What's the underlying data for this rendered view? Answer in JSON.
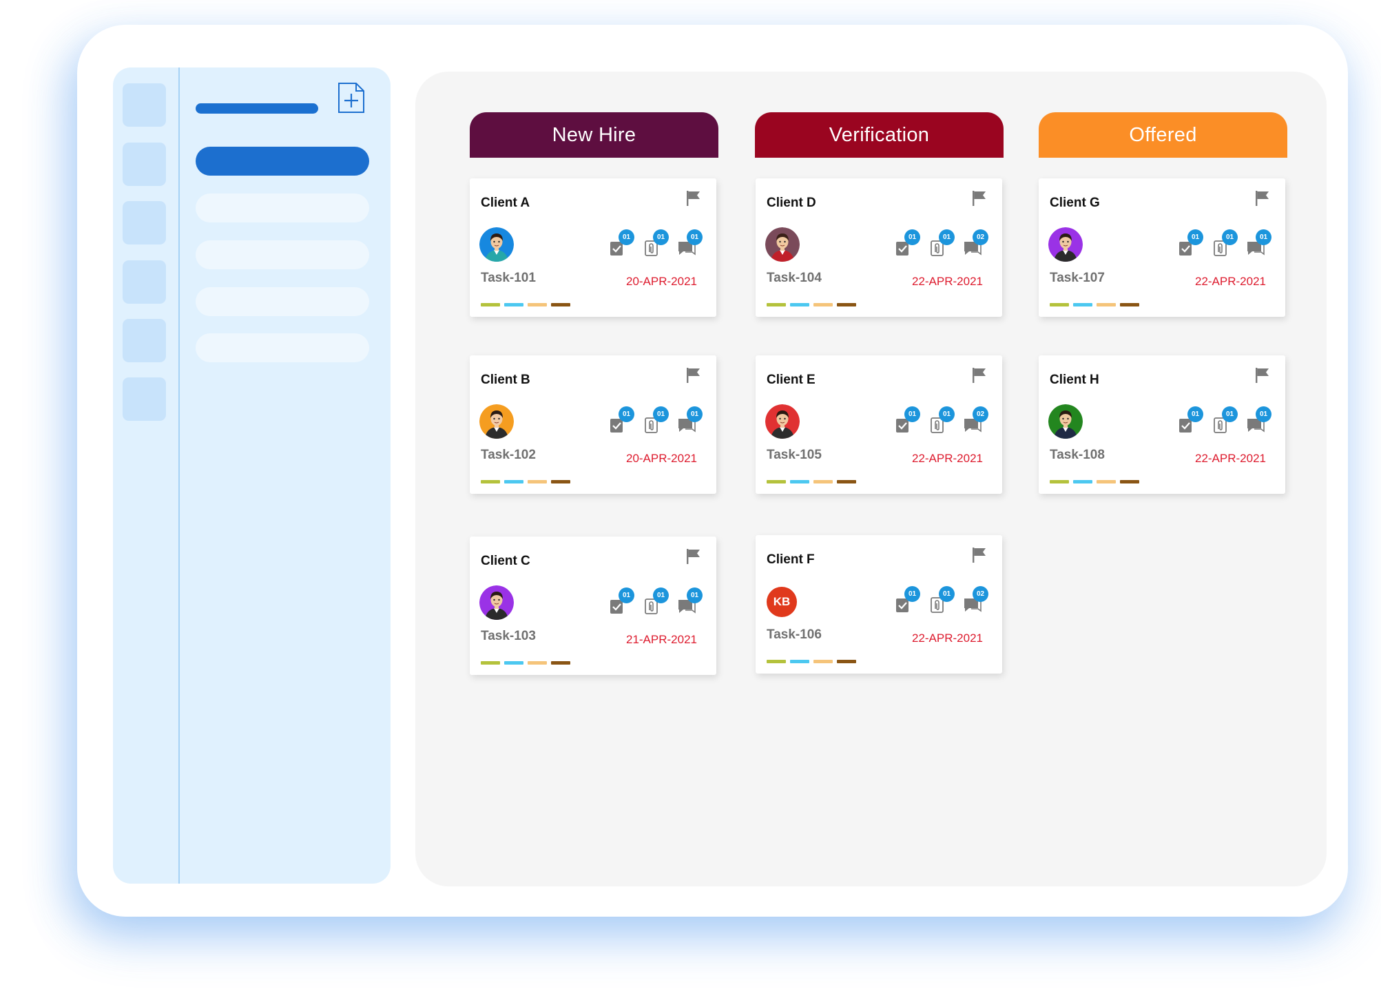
{
  "colors": {
    "frame_bg": "#ffffff",
    "sidebar_bg": "#e0f1fe",
    "accent_blue": "#1c6fcf",
    "board_bg": "#f5f5f5",
    "badge": "#1c95dc",
    "date_red": "#dd1a2d",
    "icon_gray": "#7a7a7a",
    "tags": [
      "#b4c23c",
      "#4cc8f0",
      "#f5c47a",
      "#8a5514"
    ]
  },
  "sidebar": {
    "new_icon": "file-plus-icon",
    "rail_item_count": 6,
    "nav_item_count": 5,
    "active_nav_index": 0
  },
  "board": {
    "columns": [
      {
        "title": "New Hire",
        "color": "#5e0e40",
        "cards": [
          {
            "client": "Client A",
            "task": "Task-101",
            "date": "20-APR-2021",
            "avatar": {
              "type": "person",
              "bg": "#1788df",
              "skin": "#f0c9a0",
              "hair": "#2e1c12",
              "shirt": "#26a7a9"
            },
            "counts": {
              "checklist": "01",
              "attachments": "01",
              "comments": "01"
            }
          },
          {
            "client": "Client B",
            "task": "Task-102",
            "date": "20-APR-2021",
            "avatar": {
              "type": "person",
              "bg": "#f59d20",
              "skin": "#f2cba5",
              "hair": "#2a1c14",
              "shirt": "#2c2c2c"
            },
            "counts": {
              "checklist": "01",
              "attachments": "01",
              "comments": "01"
            }
          },
          {
            "client": "Client C",
            "task": "Task-103",
            "date": "21-APR-2021",
            "avatar": {
              "type": "person",
              "bg": "#9a32e6",
              "skin": "#efc9a2",
              "hair": "#2a1c14",
              "shirt": "#2b2b2b"
            },
            "counts": {
              "checklist": "01",
              "attachments": "01",
              "comments": "01"
            }
          }
        ]
      },
      {
        "title": "Verification",
        "color": "#9a0520",
        "cards": [
          {
            "client": "Client D",
            "task": "Task-104",
            "date": "22-APR-2021",
            "avatar": {
              "type": "person",
              "bg": "#7a4a5a",
              "skin": "#f0c9a0",
              "hair": "#3a2018",
              "shirt": "#c0202a"
            },
            "counts": {
              "checklist": "01",
              "attachments": "01",
              "comments": "02"
            }
          },
          {
            "client": "Client E",
            "task": "Task-105",
            "date": "22-APR-2021",
            "avatar": {
              "type": "person",
              "bg": "#e03132",
              "skin": "#f0c9a0",
              "hair": "#2a1a12",
              "shirt": "#2d2d2d"
            },
            "counts": {
              "checklist": "01",
              "attachments": "01",
              "comments": "02"
            }
          },
          {
            "client": "Client F",
            "task": "Task-106",
            "date": "22-APR-2021",
            "avatar": {
              "type": "initials",
              "initials": "KB",
              "bg": "#e0391c"
            },
            "counts": {
              "checklist": "01",
              "attachments": "01",
              "comments": "02"
            }
          }
        ]
      },
      {
        "title": "Offered",
        "color": "#fb8e26",
        "cards": [
          {
            "client": "Client G",
            "task": "Task-107",
            "date": "22-APR-2021",
            "avatar": {
              "type": "person",
              "bg": "#9a32e6",
              "skin": "#efc9a2",
              "hair": "#2a1c14",
              "shirt": "#2b2b2b"
            },
            "counts": {
              "checklist": "01",
              "attachments": "01",
              "comments": "01"
            }
          },
          {
            "client": "Client H",
            "task": "Task-108",
            "date": "22-APR-2021",
            "avatar": {
              "type": "person",
              "bg": "#23861f",
              "skin": "#f0c9a0",
              "hair": "#2a1a12",
              "shirt": "#1f2a44"
            },
            "counts": {
              "checklist": "01",
              "attachments": "01",
              "comments": "01"
            }
          }
        ]
      }
    ]
  }
}
